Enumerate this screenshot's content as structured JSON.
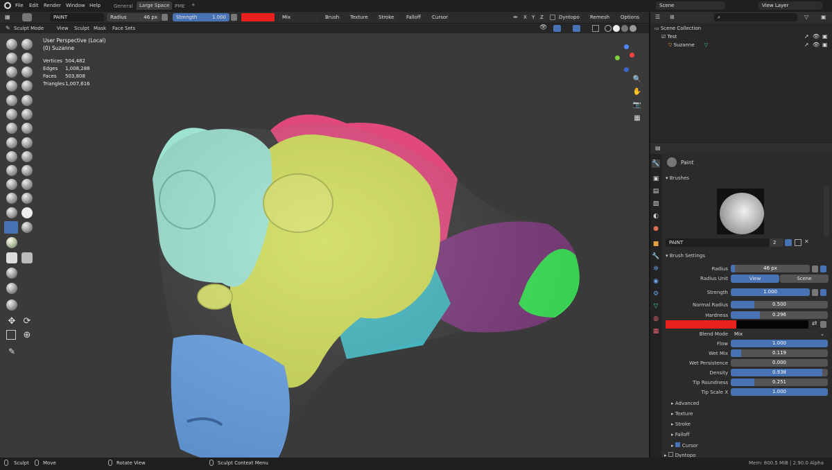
{
  "topbar": {
    "menus": [
      "File",
      "Edit",
      "Render",
      "Window",
      "Help"
    ],
    "workspaces": [
      "General",
      "Large Space",
      "PME"
    ],
    "add_tab": "+",
    "scene": "Scene",
    "view_layer": "View Layer"
  },
  "tool_header": {
    "brush_name": "PAINT",
    "radius_label": "Radius",
    "radius_value": "46 px",
    "strength_label": "Strength",
    "strength_value": "1.000",
    "color": "#e8201e",
    "blend": "Mix",
    "menus": [
      "Brush",
      "Texture",
      "Stroke",
      "Falloff",
      "Cursor"
    ],
    "axes": [
      "X",
      "Y",
      "Z"
    ],
    "dyntopo": "Dyntopo",
    "remesh": "Remesh",
    "options": "Options"
  },
  "viewport_header": {
    "mode": "Sculpt Mode",
    "menus": [
      "View",
      "Sculpt",
      "Mask",
      "Face Sets"
    ]
  },
  "overlay": {
    "view_name": "User Perspective (Local)",
    "object": "(0) Suzanne",
    "stats": [
      {
        "label": "Vertices",
        "value": "504,482"
      },
      {
        "label": "Edges",
        "value": "1,008,288"
      },
      {
        "label": "Faces",
        "value": "503,808"
      },
      {
        "label": "Triangles",
        "value": "1,007,616"
      }
    ]
  },
  "outliner": {
    "root": "Scene Collection",
    "items": [
      "Test",
      "Suzanne"
    ]
  },
  "properties": {
    "header": "Paint",
    "brushes_panel": "Brushes",
    "brush_name": "PAINT",
    "brush_users": "2",
    "brush_settings": "Brush Settings",
    "radius": {
      "label": "Radius",
      "value": "46 px"
    },
    "radius_unit": {
      "label": "Radius Unit",
      "options": [
        "View",
        "Scene"
      ]
    },
    "strength": {
      "label": "Strength",
      "value": "1.000",
      "fraction": 1.0
    },
    "normal_radius": {
      "label": "Normal Radius",
      "value": "0.500",
      "fraction": 0.24
    },
    "hardness": {
      "label": "Hardness",
      "value": "0.296",
      "fraction": 0.3
    },
    "color": "#e8201e",
    "blend_mode": {
      "label": "Blend Mode",
      "value": "Mix"
    },
    "flow": {
      "label": "Flow",
      "value": "1.000",
      "fraction": 1.0
    },
    "wet_mix": {
      "label": "Wet Mix",
      "value": "0.119",
      "fraction": 0.11
    },
    "wet_persistence": {
      "label": "Wet Persistence",
      "value": "0.000",
      "fraction": 0.0
    },
    "density": {
      "label": "Density",
      "value": "0.938",
      "fraction": 0.94
    },
    "tip_roundness": {
      "label": "Tip Roundness",
      "value": "0.251",
      "fraction": 0.24
    },
    "tip_scale_x": {
      "label": "Tip Scale X",
      "value": "1.000",
      "fraction": 1.0
    },
    "subpanels": [
      "Advanced",
      "Texture",
      "Stroke",
      "Falloff",
      "Cursor"
    ],
    "dyntopo": "Dyntopo"
  },
  "statusbar": {
    "items": [
      "Sculpt",
      "Move",
      "Rotate View",
      "Sculpt Context Menu"
    ],
    "memory": "Mem: 800.5 MiB | 2.90.0 Alpha"
  }
}
